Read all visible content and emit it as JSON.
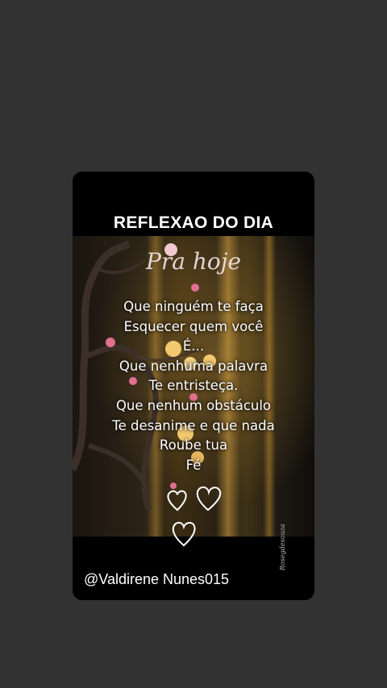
{
  "card": {
    "title": "REFLEXAO DO DIA",
    "script_title": "Pra hoje",
    "poem_lines": [
      "Que ninguém te faça",
      "Esquecer quem você",
      "É...",
      "Que nenhuma palavra",
      "Te entristeça.",
      "Que nenhum obstáculo",
      "Te desanime e que nada",
      "Roube tua",
      "Fé"
    ],
    "signature": "Rosegdesouza",
    "handle": "@Valdirene Nunes015"
  },
  "colors": {
    "page_background": "#323232",
    "card_background": "#000000",
    "text": "#ffffff"
  },
  "icons": [
    "heart-icon",
    "heart-icon",
    "heart-icon"
  ]
}
